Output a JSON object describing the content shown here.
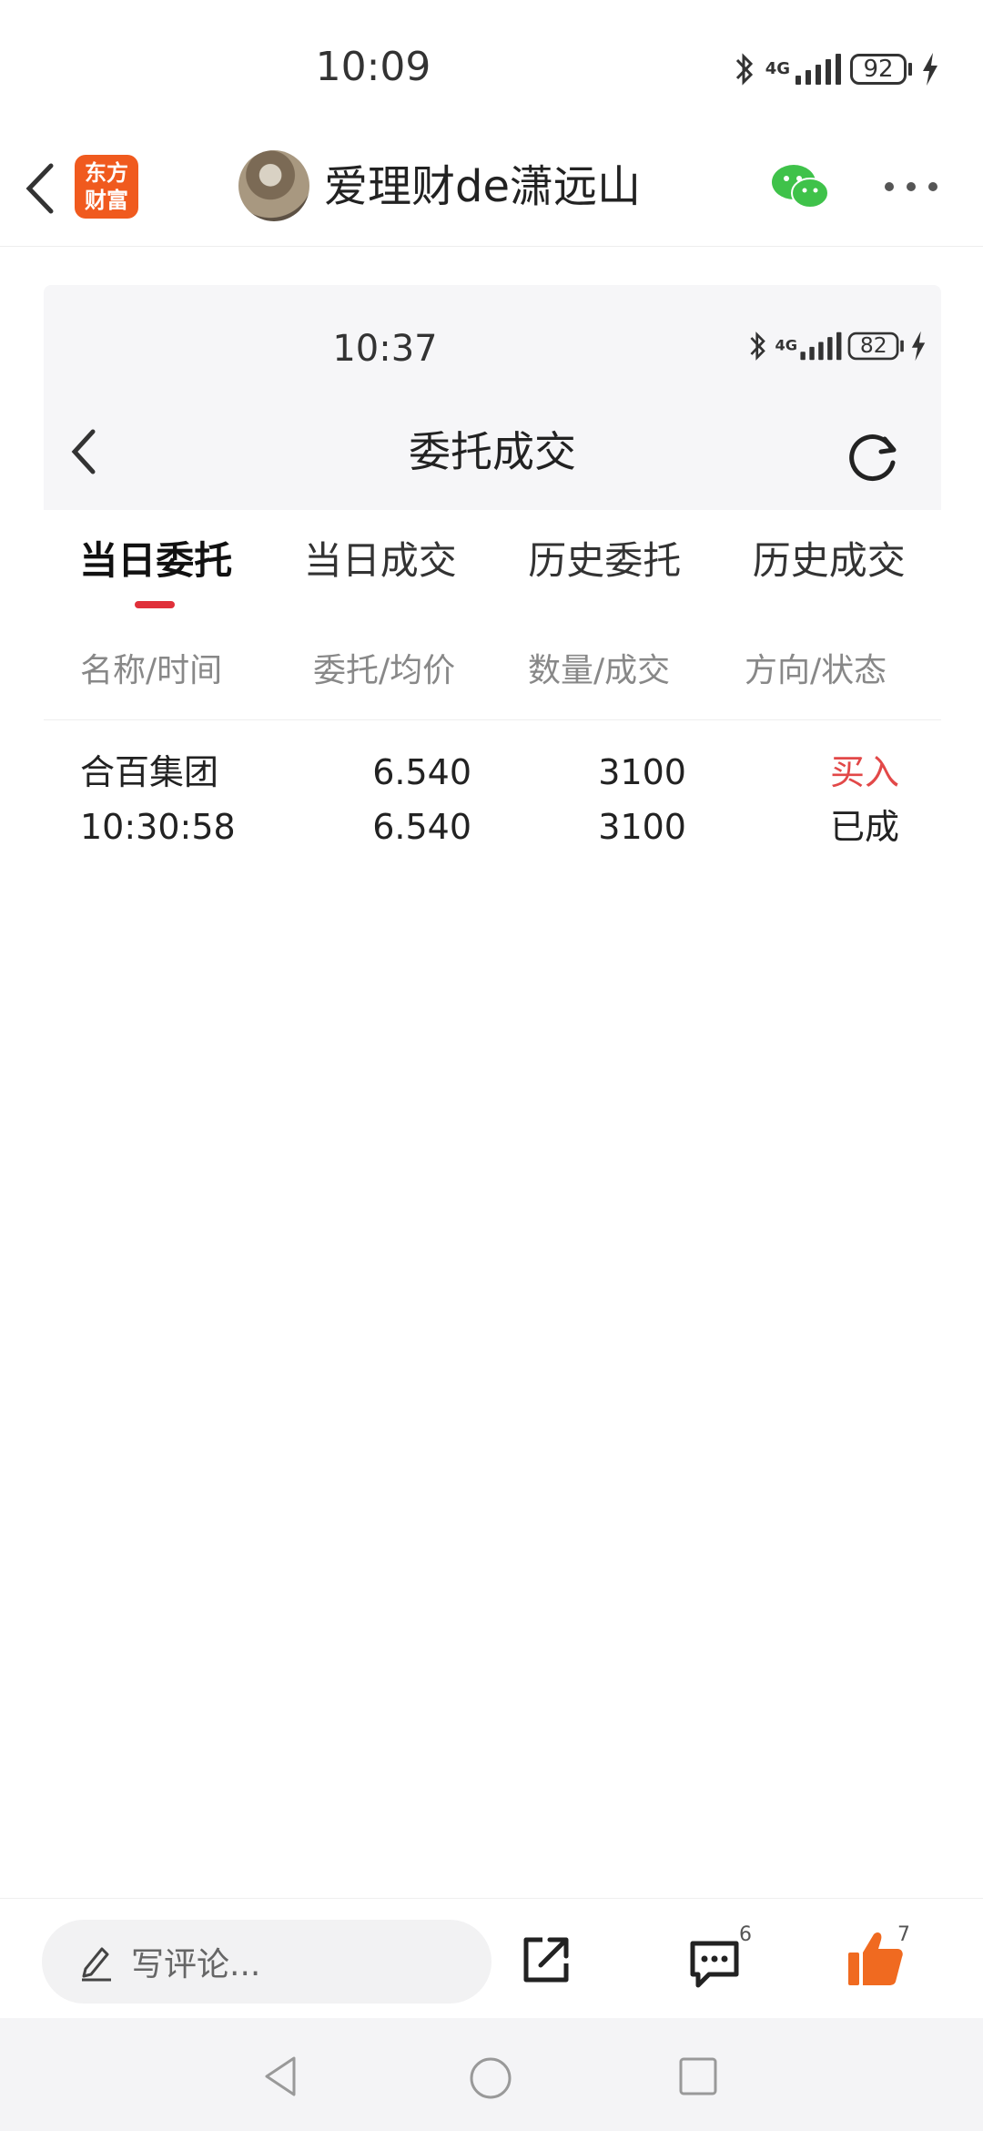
{
  "status_bar": {
    "time": "10:09",
    "network": "4G",
    "battery": "92"
  },
  "header": {
    "logo_line1": "东方",
    "logo_line2": "财富",
    "author": "爱理财de潇远山"
  },
  "inner": {
    "status_bar": {
      "time": "10:37",
      "network": "4G",
      "battery": "82"
    },
    "title": "委托成交",
    "tabs": [
      {
        "label": "当日委托",
        "active": true
      },
      {
        "label": "当日成交",
        "active": false
      },
      {
        "label": "历史委托",
        "active": false
      },
      {
        "label": "历史成交",
        "active": false
      }
    ],
    "columns": [
      "名称/时间",
      "委托/均价",
      "数量/成交",
      "方向/状态"
    ],
    "rows": [
      {
        "name": "合百集团",
        "time": "10:30:58",
        "order_price": "6.540",
        "avg_price": "6.540",
        "quantity": "3100",
        "filled": "3100",
        "direction": "买入",
        "status": "已成"
      }
    ]
  },
  "bottom": {
    "comment_placeholder": "写评论...",
    "comment_count": "6",
    "like_count": "7"
  },
  "colors": {
    "accent_red": "#e0303a",
    "buy_red": "#e24848",
    "brand_orange": "#f05a1e",
    "wechat_green": "#3fc24a",
    "like_orange": "#f06a20"
  }
}
